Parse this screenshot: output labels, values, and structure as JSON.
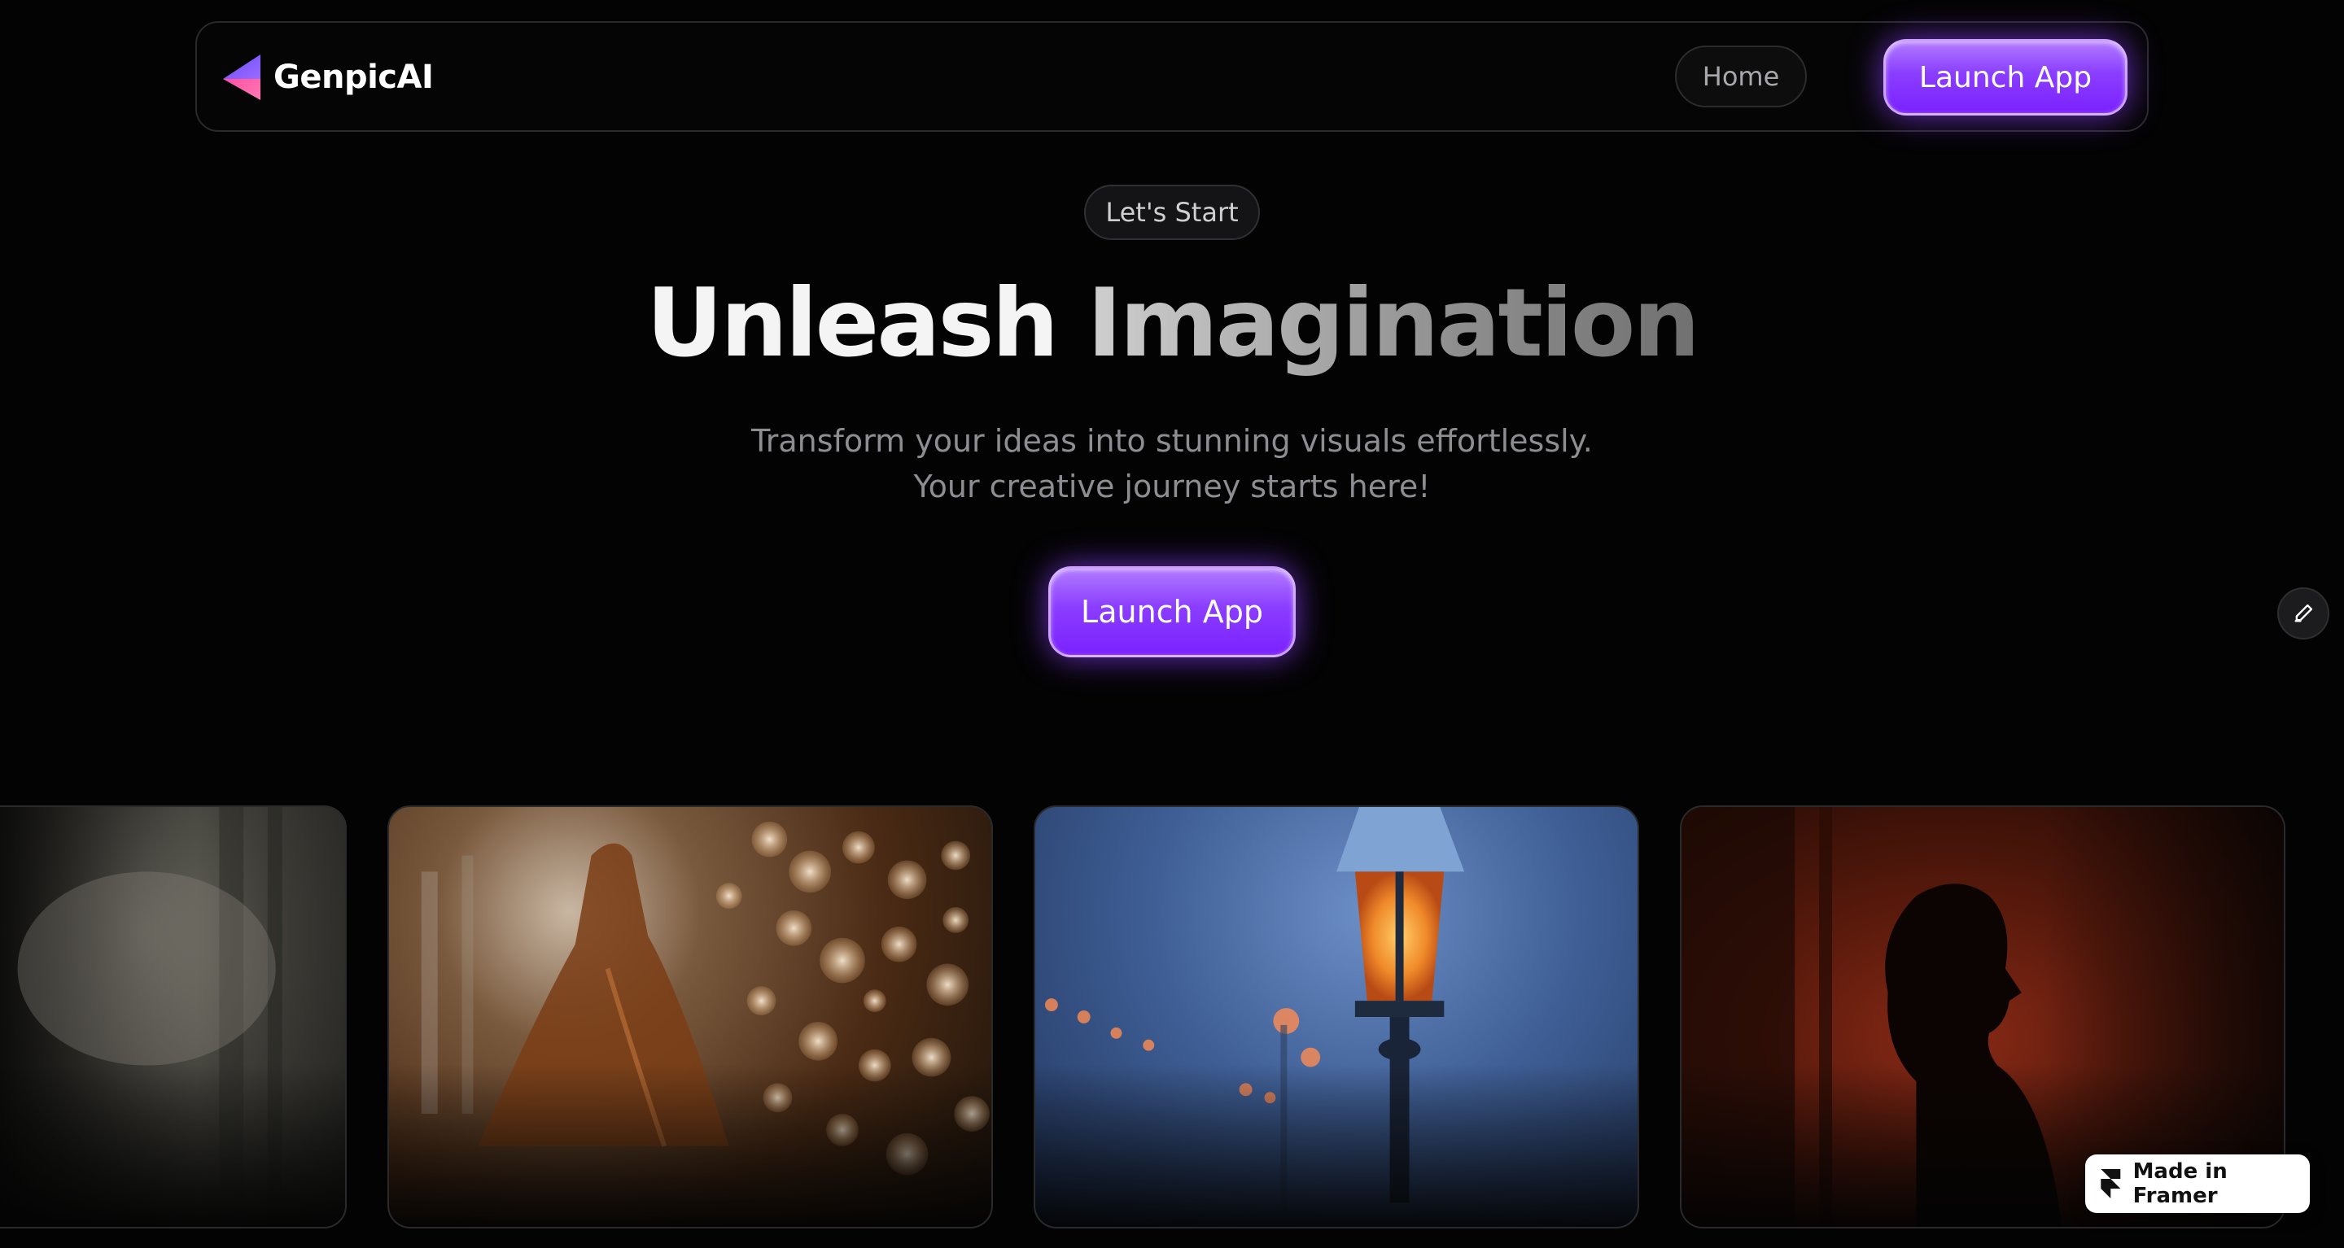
{
  "header": {
    "brand": "GenpicAI",
    "nav_home": "Home",
    "nav_launch": "Launch App"
  },
  "hero": {
    "tag": "Let's Start",
    "title_word1": "Unleash",
    "title_word2": "Imagination",
    "subtitle_line1": "Transform your ideas into stunning visuals effortlessly.",
    "subtitle_line2": "Your creative journey starts here!",
    "cta": "Launch App"
  },
  "gallery": {
    "images": [
      {
        "subject": "misty forest path"
      },
      {
        "subject": "woman in sparkling gown with bokeh lights"
      },
      {
        "subject": "street lamp in blue fog"
      },
      {
        "subject": "silhouette against red wall"
      }
    ]
  },
  "badge": {
    "label": "Made in Framer"
  },
  "colors": {
    "accent": "#8a3dff",
    "background": "#030303",
    "muted_text": "#8d8d92"
  },
  "icons": {
    "logo": "genpic-logo-icon",
    "edit": "pencil-icon",
    "framer": "framer-icon"
  }
}
